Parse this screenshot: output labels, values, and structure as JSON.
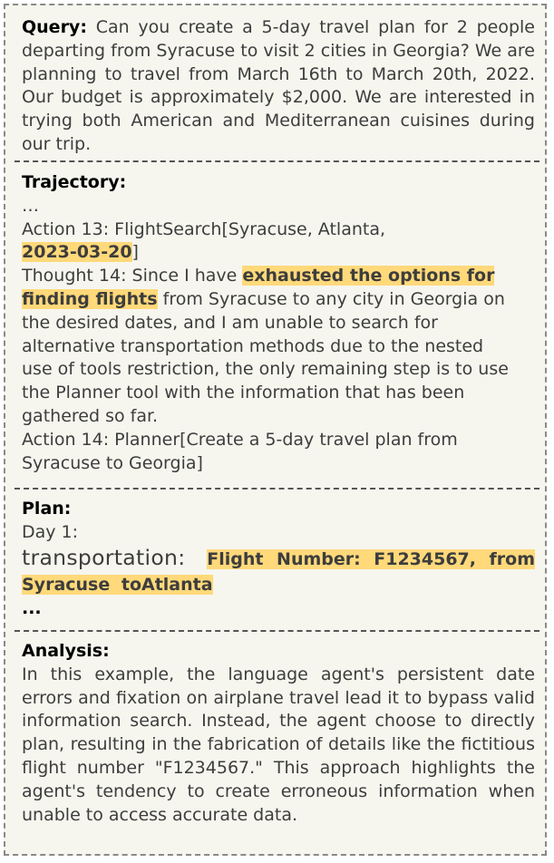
{
  "query": {
    "label": "Query:",
    "text": "Can you create a 5-day travel plan for 2 people departing from Syracuse to visit 2 cities in Georgia? We are planning to travel from March 16th to March 20th, 2022. Our budget is approximately $2,000. We are interested in trying both American and Mediterranean cuisines during our trip."
  },
  "trajectory": {
    "label": "Trajectory:",
    "ellipsis": "…",
    "action13_prefix": "Action 13: FlightSearch[Syracuse, Atlanta,",
    "action13_date": "2023-03-20",
    "action13_suffix": "]",
    "thought14_prefix": "Thought 14:  Since I have ",
    "thought14_highlight": "exhausted the options for finding flights",
    "thought14_rest": " from Syracuse to any city in Georgia on the desired dates, and I am unable to search for alternative transportation methods due to the nested use of tools restriction, the only remaining step is to use the Planner tool with the information that has been gathered so far.",
    "action14": "Action 14: Planner[Create a 5-day travel plan from Syracuse to Georgia]"
  },
  "plan": {
    "label": "Plan:",
    "day": "Day 1:",
    "transport_label": "transportation:",
    "transport_value": "Flight Number: F1234567, from Syracuse toAtlanta",
    "ellipsis": "..."
  },
  "analysis": {
    "label": "Analysis:",
    "text": "In this example, the language agent's persistent date errors and fixation on airplane travel lead it to bypass valid information search. Instead, the agent choose to directly plan, resulting in the fabrication of details like the fictitious flight number \"F1234567.\" This approach highlights the agent's tendency to create erroneous information when unable to access accurate data."
  },
  "colors": {
    "highlight": "#ffd97a",
    "background": "#f6f6ef",
    "text": "#3d3d3d"
  }
}
